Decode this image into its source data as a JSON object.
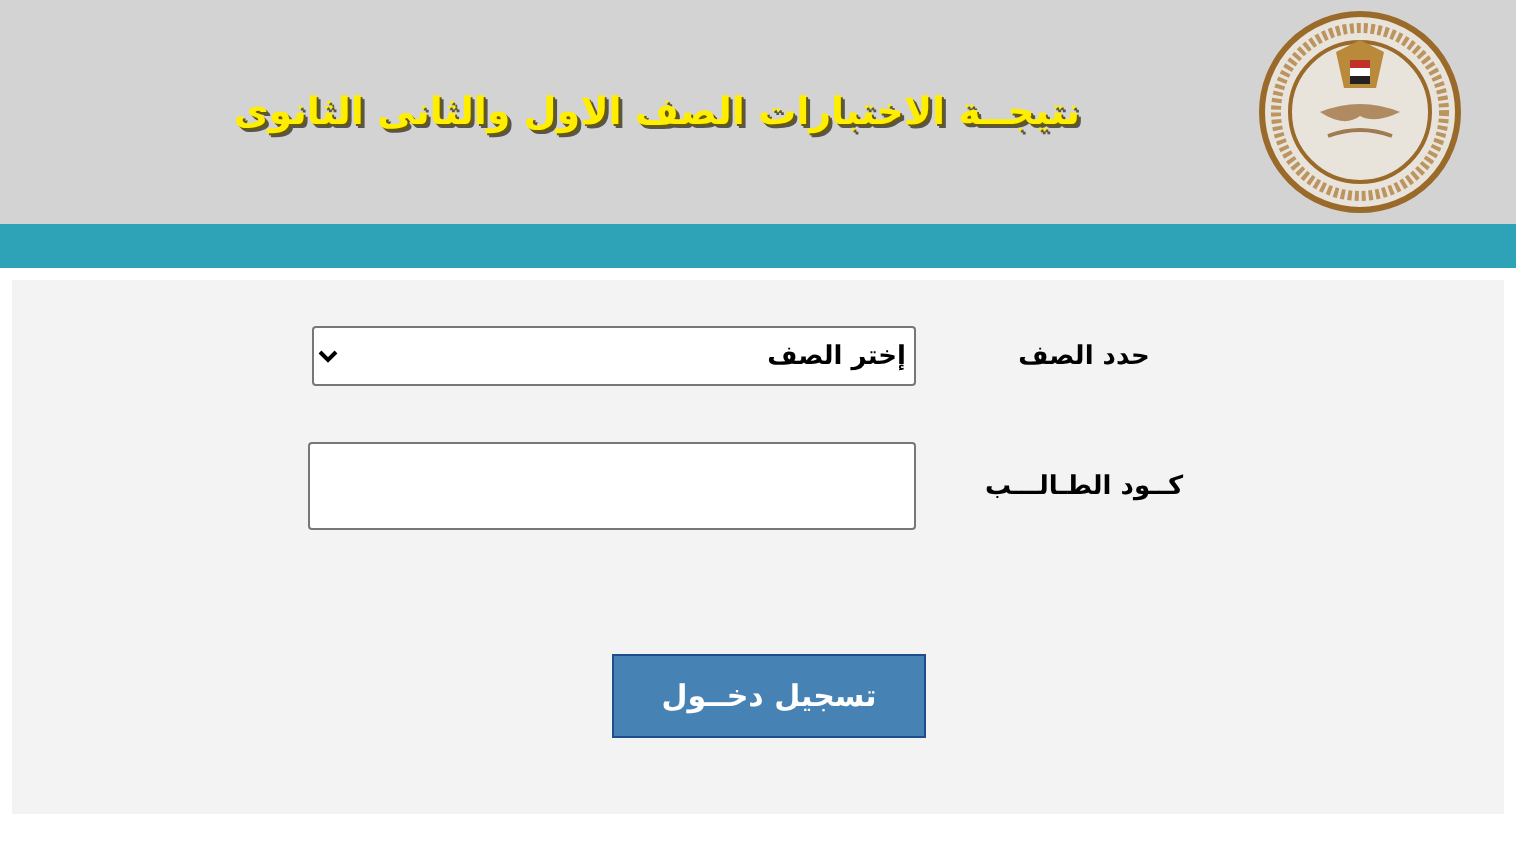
{
  "header": {
    "title": "نتيجــة  الاختبارات الصف الاول والثانى الثانوى"
  },
  "form": {
    "fields": [
      {
        "kind": "select",
        "label": "حدد الصف",
        "value": "إختر الصف"
      },
      {
        "kind": "text",
        "label": "كــود الطـالـــب"
      }
    ],
    "submit": "تسجيل دخــول"
  }
}
